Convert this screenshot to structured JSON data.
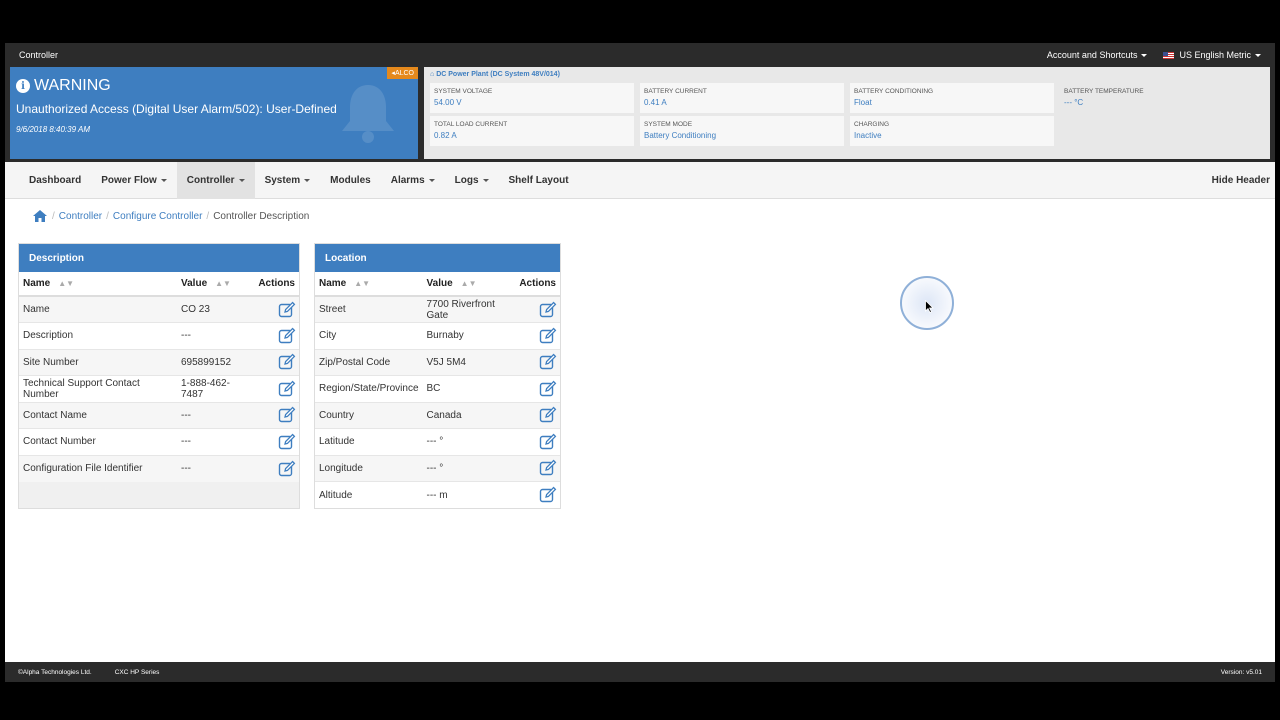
{
  "topbar": {
    "title": "Controller",
    "account": "Account and Shortcuts",
    "language": "US English Metric"
  },
  "warning": {
    "title": "WARNING",
    "message": "Unauthorized Access (Digital User Alarm/502): User-Defined",
    "timestamp": "9/6/2018 8:40:39 AM",
    "badge": "ALCO"
  },
  "plant": {
    "title": "DC Power Plant (DC System 48V/014)",
    "metrics": [
      {
        "label": "SYSTEM VOLTAGE",
        "value": "54.00 V"
      },
      {
        "label": "BATTERY CURRENT",
        "value": "0.41 A"
      },
      {
        "label": "BATTERY CONDITIONING",
        "value": "Float"
      },
      {
        "label": "BATTERY TEMPERATURE",
        "value": "--- °C"
      },
      {
        "label": "TOTAL LOAD CURRENT",
        "value": "0.82 A"
      },
      {
        "label": "SYSTEM MODE",
        "value": "Battery Conditioning"
      },
      {
        "label": "CHARGING",
        "value": "Inactive"
      }
    ]
  },
  "nav": {
    "items": [
      "Dashboard",
      "Power Flow",
      "Controller",
      "System",
      "Modules",
      "Alarms",
      "Logs",
      "Shelf Layout"
    ],
    "hide_header": "Hide Header"
  },
  "breadcrumb": {
    "controller": "Controller",
    "configure": "Configure Controller",
    "current": "Controller Description"
  },
  "description_panel": {
    "title": "Description",
    "col_name": "Name",
    "col_value": "Value",
    "col_actions": "Actions",
    "rows": [
      {
        "name": "Name",
        "value": "CO 23"
      },
      {
        "name": "Description",
        "value": "---"
      },
      {
        "name": "Site Number",
        "value": "695899152"
      },
      {
        "name": "Technical Support Contact Number",
        "value": "1-888-462-7487"
      },
      {
        "name": "Contact Name",
        "value": "---"
      },
      {
        "name": "Contact Number",
        "value": "---"
      },
      {
        "name": "Configuration File Identifier",
        "value": "---"
      }
    ]
  },
  "location_panel": {
    "title": "Location",
    "col_name": "Name",
    "col_value": "Value",
    "col_actions": "Actions",
    "rows": [
      {
        "name": "Street",
        "value": "7700 Riverfront Gate"
      },
      {
        "name": "City",
        "value": "Burnaby"
      },
      {
        "name": "Zip/Postal Code",
        "value": "V5J 5M4"
      },
      {
        "name": "Region/State/Province",
        "value": "BC"
      },
      {
        "name": "Country",
        "value": "Canada"
      },
      {
        "name": "Latitude",
        "value": "--- °"
      },
      {
        "name": "Longitude",
        "value": "--- °"
      },
      {
        "name": "Altitude",
        "value": "--- m"
      }
    ]
  },
  "footer": {
    "copyright": "©Alpha Technologies Ltd.",
    "series": "CXC HP Series",
    "version": "Version: v5.01"
  },
  "colors": {
    "accent": "#3e7ec0",
    "alco_badge": "#e5891c",
    "dark_bar": "#2b2b2b"
  },
  "icons": [
    "info-icon",
    "bell-icon",
    "home-icon",
    "edit-icon",
    "sort-icon",
    "chevron-down-icon",
    "flag-icon"
  ]
}
